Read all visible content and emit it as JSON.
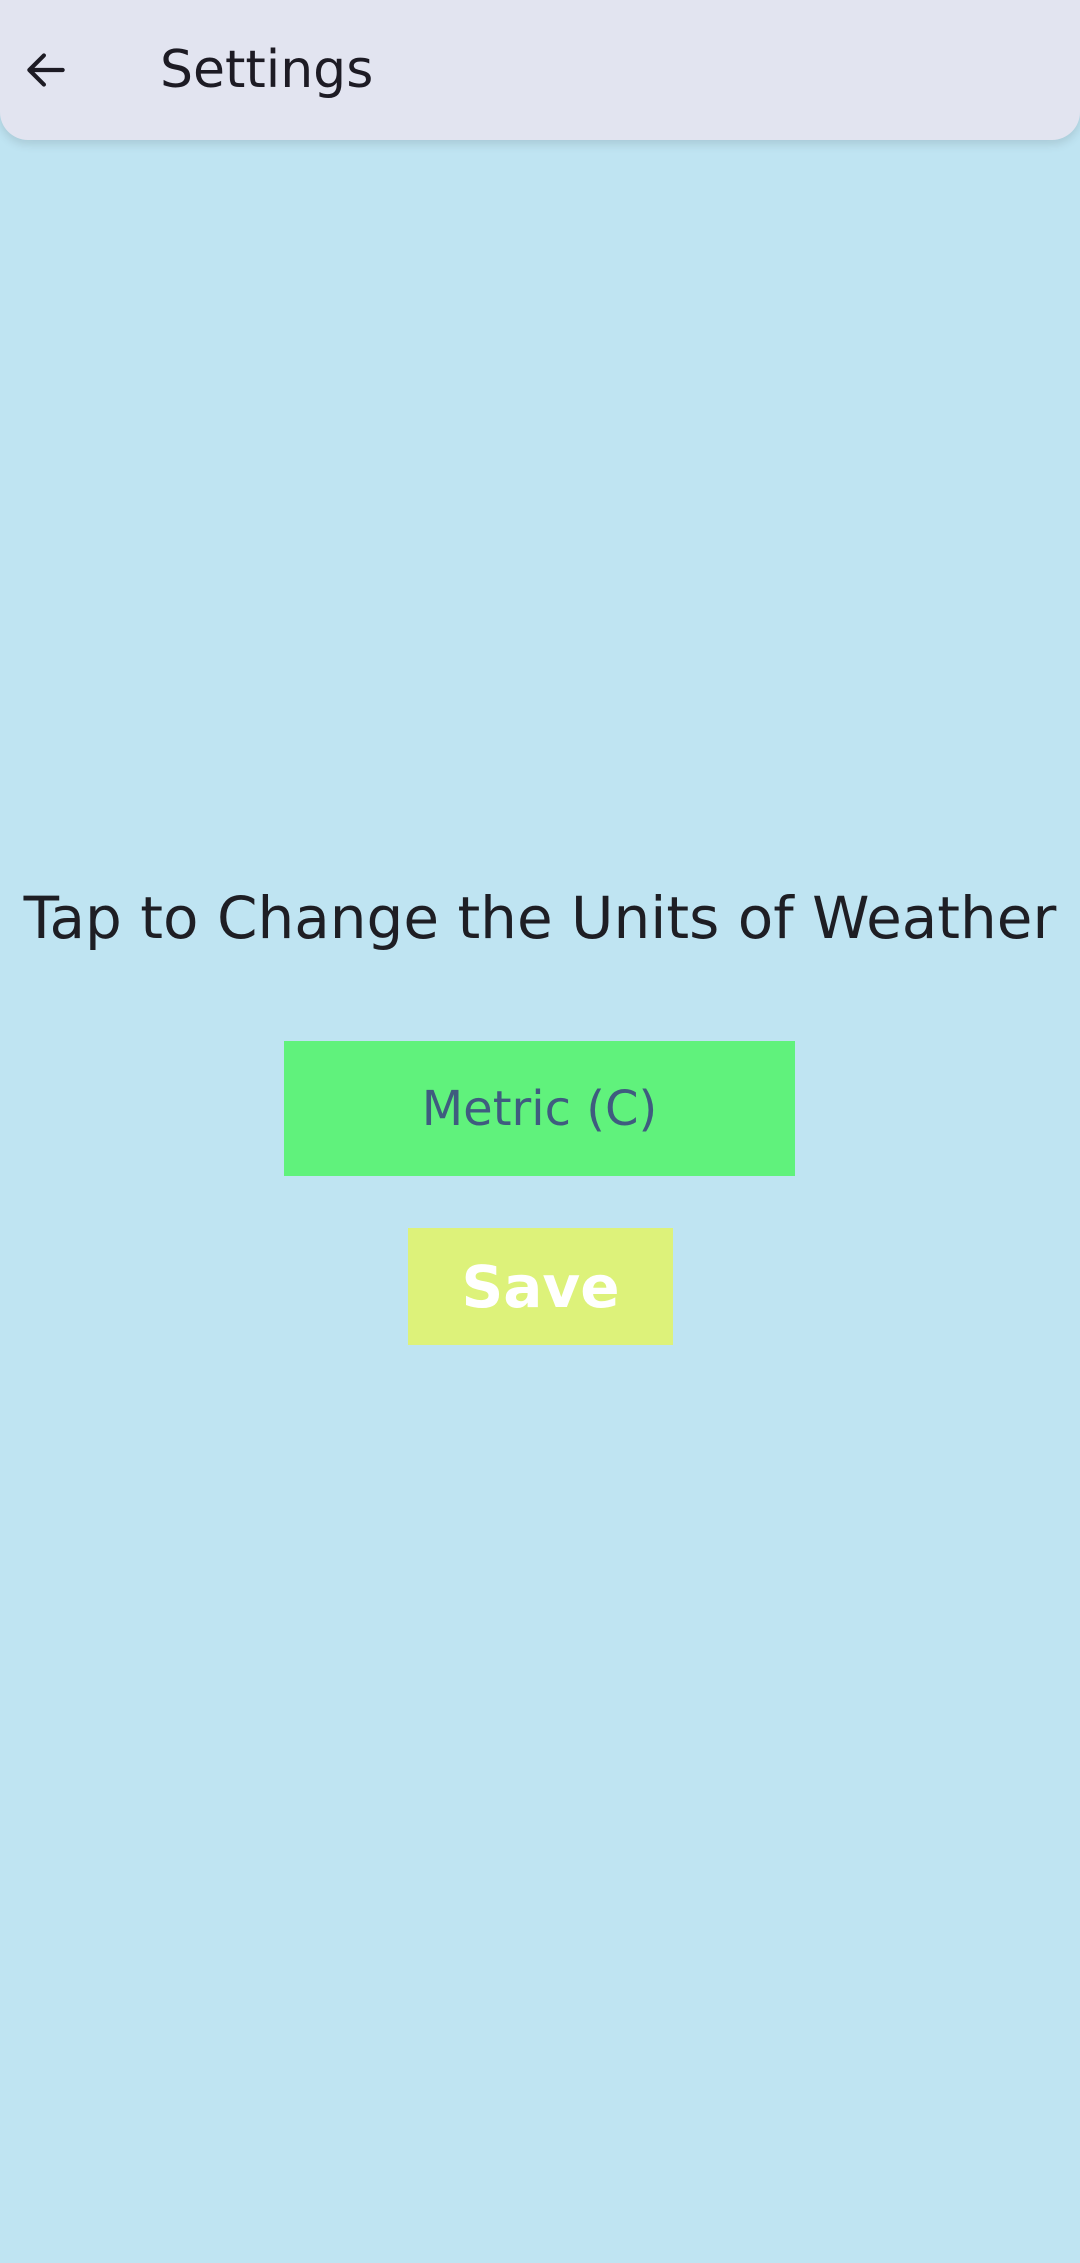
{
  "app_bar": {
    "title": "Settings",
    "back_icon": "arrow-back-icon"
  },
  "main": {
    "instruction": "Tap to Change the Units of Weather",
    "units_button_label": "Metric (C)",
    "save_button_label": "Save"
  },
  "colors": {
    "background": "#bfe4f2",
    "app_bar": "#e2e4f0",
    "units_button": "#60f27c",
    "units_button_text": "#3f5c7f",
    "save_button": "#ddf27a",
    "save_button_text": "#ffffff"
  }
}
